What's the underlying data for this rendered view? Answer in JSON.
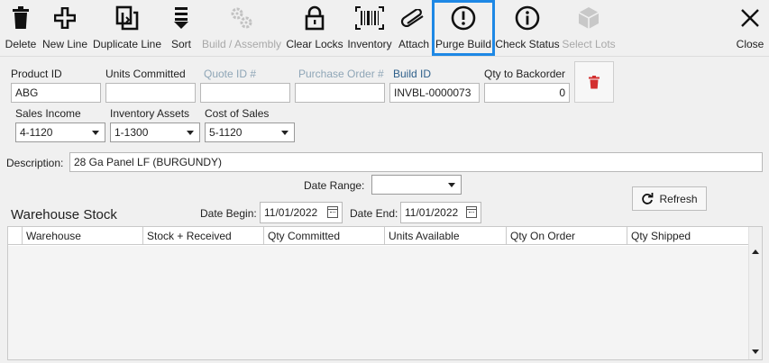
{
  "toolbar": {
    "delete": "Delete",
    "new_line": "New Line",
    "duplicate_line": "Duplicate Line",
    "sort": "Sort",
    "build_assembly": "Build / Assembly",
    "clear_locks": "Clear Locks",
    "inventory": "Inventory",
    "attach": "Attach",
    "purge_build": "Purge Build",
    "check_status": "Check Status",
    "select_lots": "Select Lots",
    "close": "Close"
  },
  "form": {
    "product_id_label": "Product ID",
    "product_id_value": "ABG",
    "units_committed_label": "Units Committed",
    "units_committed_value": "",
    "quote_id_label": "Quote ID #",
    "quote_id_value": "",
    "purchase_order_label": "Purchase Order #",
    "purchase_order_value": "",
    "build_id_label": "Build ID",
    "build_id_value": "INVBL-0000073",
    "qty_backorder_label": "Qty to Backorder",
    "qty_backorder_value": "0",
    "sales_income_label": "Sales Income",
    "sales_income_value": "4-1120",
    "inventory_assets_label": "Inventory Assets",
    "inventory_assets_value": "1-1300",
    "cost_of_sales_label": "Cost of Sales",
    "cost_of_sales_value": "5-1120",
    "description_label": "Description:",
    "description_value": "28 Ga Panel LF (BURGUNDY)",
    "date_range_label": "Date Range:",
    "date_range_value": "",
    "date_begin_label": "Date Begin:",
    "date_begin_value": "11/01/2022",
    "date_end_label": "Date End:",
    "date_end_value": "11/01/2022",
    "refresh_label": "Refresh"
  },
  "warehouse": {
    "title": "Warehouse Stock",
    "columns": [
      "Warehouse",
      "Stock + Received",
      "Qty Committed",
      "Units Available",
      "Qty On Order",
      "Qty Shipped"
    ]
  },
  "colors": {
    "accent": "#1e88e5",
    "delete_red": "#d32f2f"
  }
}
